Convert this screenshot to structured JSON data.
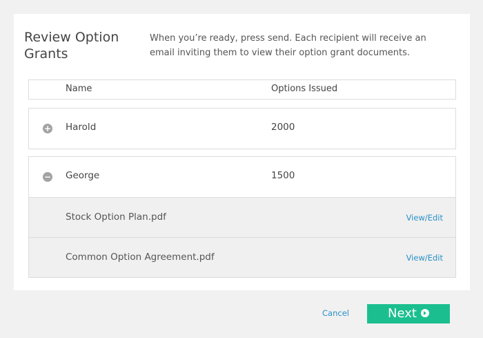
{
  "header": {
    "title": "Review Option Grants",
    "description": "When you’re ready, press send. Each recipient will receive an email inviting them to view their option grant documents."
  },
  "table": {
    "columns": [
      "Name",
      "Options Issued"
    ],
    "recipients": [
      {
        "name": "Harold",
        "options": "2000",
        "expanded": false,
        "toggle_icon": "plus-circle-icon",
        "documents": []
      },
      {
        "name": "George",
        "options": "1500",
        "expanded": true,
        "toggle_icon": "minus-circle-icon",
        "documents": [
          {
            "name": "Stock Option Plan.pdf",
            "action": "View/Edit"
          },
          {
            "name": "Common Option Agreement.pdf",
            "action": "View/Edit"
          }
        ]
      }
    ]
  },
  "footer": {
    "cancel_label": "Cancel",
    "next_label": "Next",
    "next_icon": "arrow-right-circle-icon"
  },
  "colors": {
    "accent_green": "#1bbf8f",
    "link_blue": "#2a8fc6",
    "toggle_gray": "#a3a3a3"
  }
}
